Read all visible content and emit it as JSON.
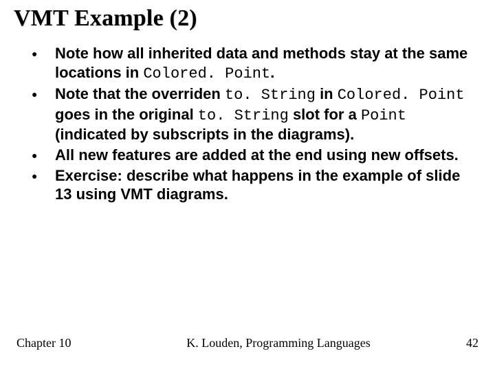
{
  "title": "VMT Example (2)",
  "bullets": [
    {
      "pre": "Note how all inherited data and methods stay at the same locations in ",
      "code1": "Colored. Point",
      "post": "."
    },
    {
      "pre": "Note that the overriden ",
      "code1": "to. String",
      "mid1": " in ",
      "code2": "Colored. Point",
      "mid2": " goes in the original ",
      "code3": "to. String",
      "mid3": " slot for a ",
      "code4": "Point",
      "post": " (indicated by subscripts in the diagrams)."
    },
    {
      "pre": "All new features are added at the end using new offsets."
    },
    {
      "pre": "Exercise: describe what happens in the example of slide 13 using VMT diagrams."
    }
  ],
  "footer": {
    "left": "Chapter 10",
    "center": "K. Louden, Programming Languages",
    "right": "42"
  }
}
